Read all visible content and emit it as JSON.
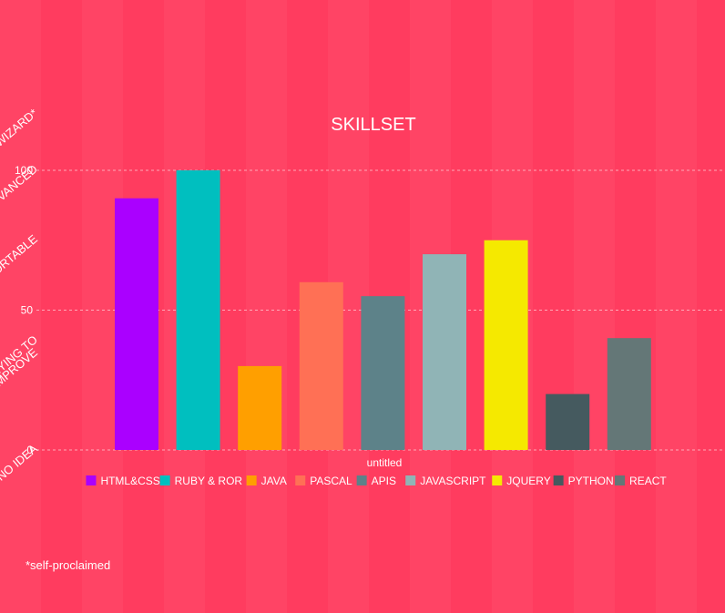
{
  "chart_data": {
    "type": "bar",
    "title": "SKILLSET",
    "xlabel": "untitled",
    "ylabel": "",
    "ylim": [
      0,
      100
    ],
    "yticks": [
      0,
      50,
      100
    ],
    "grid": true,
    "legend_position": "bottom",
    "categories": [
      "HTML&CSS",
      "RUBY & ROR",
      "JAVA",
      "PASCAL",
      "APIS",
      "JAVASCRIPT",
      "JQUERY",
      "PYTHON",
      "REACT"
    ],
    "values": [
      90,
      100,
      30,
      60,
      55,
      70,
      75,
      20,
      40
    ],
    "colors": [
      "#aa00ff",
      "#00bfbf",
      "#ff9f00",
      "#ff7055",
      "#5d8289",
      "#90b4b6",
      "#f5e900",
      "#455a5f",
      "#647777"
    ],
    "level_labels": [
      {
        "text": "NO IDEA",
        "value": 0
      },
      {
        "text": "TRYING TO",
        "value": 37
      },
      {
        "text": "IMPROVE",
        "value": 37
      },
      {
        "text": "COMFORTABLE",
        "value": 75
      },
      {
        "text": "ADVANCED",
        "value": 100
      },
      {
        "text": "WIZARD*",
        "value": 120
      }
    ]
  },
  "footnote": "*self-proclaimed"
}
